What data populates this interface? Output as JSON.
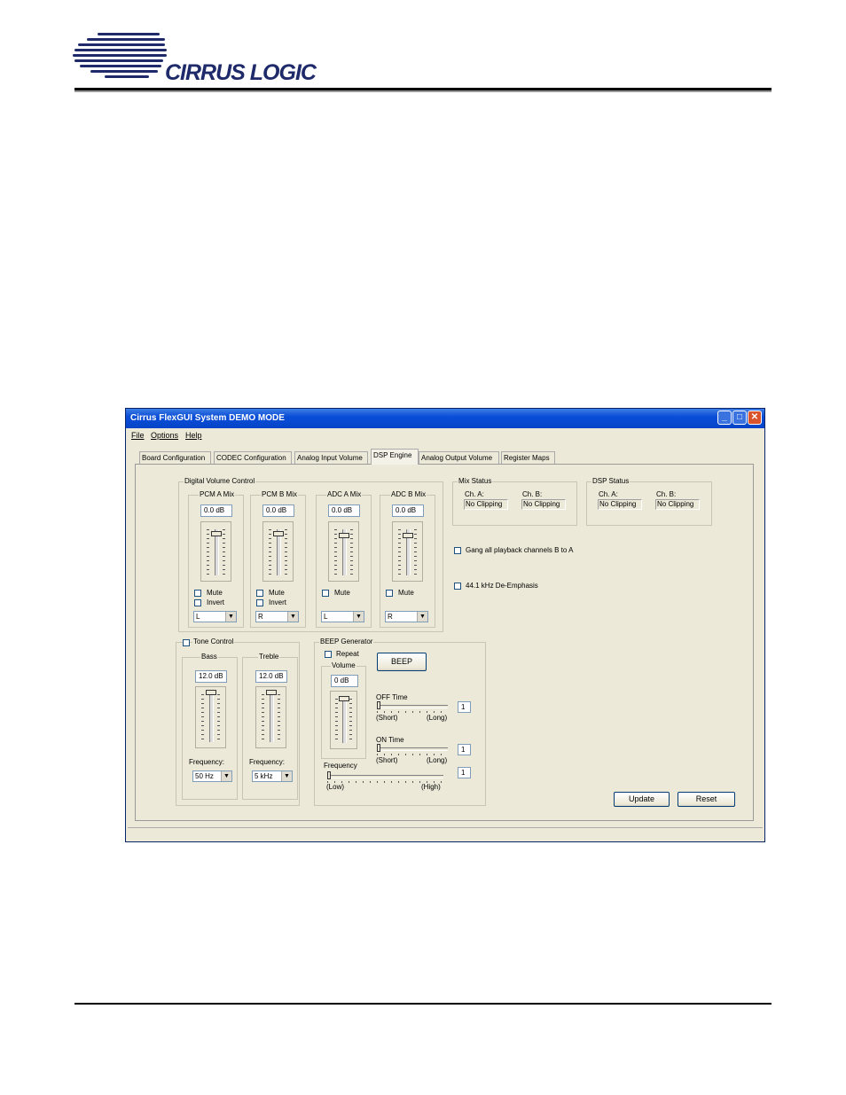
{
  "page": {
    "logo_text": "CIRRUS LOGIC"
  },
  "window": {
    "title": "Cirrus FlexGUI System DEMO MODE",
    "controls": {
      "minimize": "_",
      "maximize": "□",
      "close": "✕"
    },
    "menu": [
      "File",
      "Options",
      "Help"
    ],
    "tabs": [
      "Board Configuration",
      "CODEC Configuration",
      "Analog Input Volume",
      "DSP Engine",
      "Analog Output Volume",
      "Register Maps"
    ],
    "active_tab": "DSP Engine"
  },
  "dvc": {
    "title": "Digital Volume Control",
    "channels": [
      {
        "label": "PCM A Mix",
        "value": "0.0 dB",
        "mute": "Mute",
        "invert": "Invert",
        "select": "L"
      },
      {
        "label": "PCM B Mix",
        "value": "0.0 dB",
        "mute": "Mute",
        "invert": "Invert",
        "select": "R"
      },
      {
        "label": "ADC A Mix",
        "value": "0.0 dB",
        "mute": "Mute",
        "select": "L"
      },
      {
        "label": "ADC B Mix",
        "value": "0.0 dB",
        "mute": "Mute",
        "select": "R"
      }
    ]
  },
  "mix_status": {
    "title": "Mix Status",
    "cha_label": "Ch. A:",
    "cha_value": "No Clipping",
    "chb_label": "Ch. B:",
    "chb_value": "No Clipping"
  },
  "dsp_status": {
    "title": "DSP Status",
    "cha_label": "Ch. A:",
    "cha_value": "No Clipping",
    "chb_label": "Ch. B:",
    "chb_value": "No Clipping"
  },
  "options": {
    "gang": "Gang all playback channels B to A",
    "deemph": "44.1 kHz De-Emphasis"
  },
  "tone": {
    "title": "Tone Control",
    "bass": {
      "label": "Bass",
      "value": "12.0 dB",
      "freq_label": "Frequency:",
      "freq": "50 Hz"
    },
    "treble": {
      "label": "Treble",
      "value": "12.0 dB",
      "freq_label": "Frequency:",
      "freq": "5 kHz"
    }
  },
  "beep": {
    "title": "BEEP Generator",
    "repeat": "Repeat",
    "button": "BEEP",
    "volume_label": "Volume",
    "volume_value": "0 dB",
    "off_time": {
      "label": "OFF Time",
      "low": "(Short)",
      "high": "(Long)",
      "value": "1"
    },
    "on_time": {
      "label": "ON Time",
      "low": "(Short)",
      "high": "(Long)",
      "value": "1"
    },
    "frequency": {
      "label": "Frequency",
      "low": "(Low)",
      "high": "(High)",
      "value": "1"
    }
  },
  "actions": {
    "update": "Update",
    "reset": "Reset"
  }
}
